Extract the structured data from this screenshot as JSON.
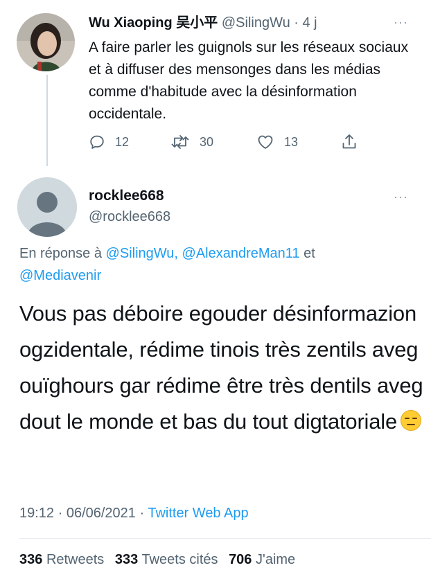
{
  "parent_tweet": {
    "name": "Wu Xiaoping 吴小平",
    "handle": "@SilingWu",
    "time": "· 4 j",
    "more": "···",
    "text": "A faire parler les guignols sur les réseaux sociaux et à diffuser des mensonges dans les médias comme d'habitude avec la désinformation occidentale.",
    "replies": "12",
    "retweets": "30",
    "likes": "13"
  },
  "main_tweet": {
    "name": "rocklee668",
    "handle": "@rocklee668",
    "more": "···",
    "reply_prefix": "En réponse à",
    "reply_mention_1": "@SilingWu,",
    "reply_mention_2": "@AlexandreMan11",
    "reply_and": "et",
    "reply_mention_3": "@Mediavenir",
    "text": "Vous pas déboire egouder désinformazion ogzidentale, rédime tinois très zentils aveg ouïghours gar rédime être très dentils aveg dout le monde et bas du tout digtatoriale",
    "time": "19:12 · 06/06/2021 ·",
    "source": "Twitter Web App",
    "retweets_count": "336",
    "retweets_label": "Retweets",
    "quotes_count": "333",
    "quotes_label": "Tweets cités",
    "likes_count": "706",
    "likes_label": "J'aime"
  },
  "icons": {
    "reply": "reply-icon",
    "retweet": "retweet-icon",
    "like": "heart-icon",
    "share": "share-icon",
    "emoji": "expressionless-face-emoji"
  },
  "colors": {
    "link": "#1d9bf0",
    "secondary": "#536471",
    "text": "#0f1419"
  }
}
